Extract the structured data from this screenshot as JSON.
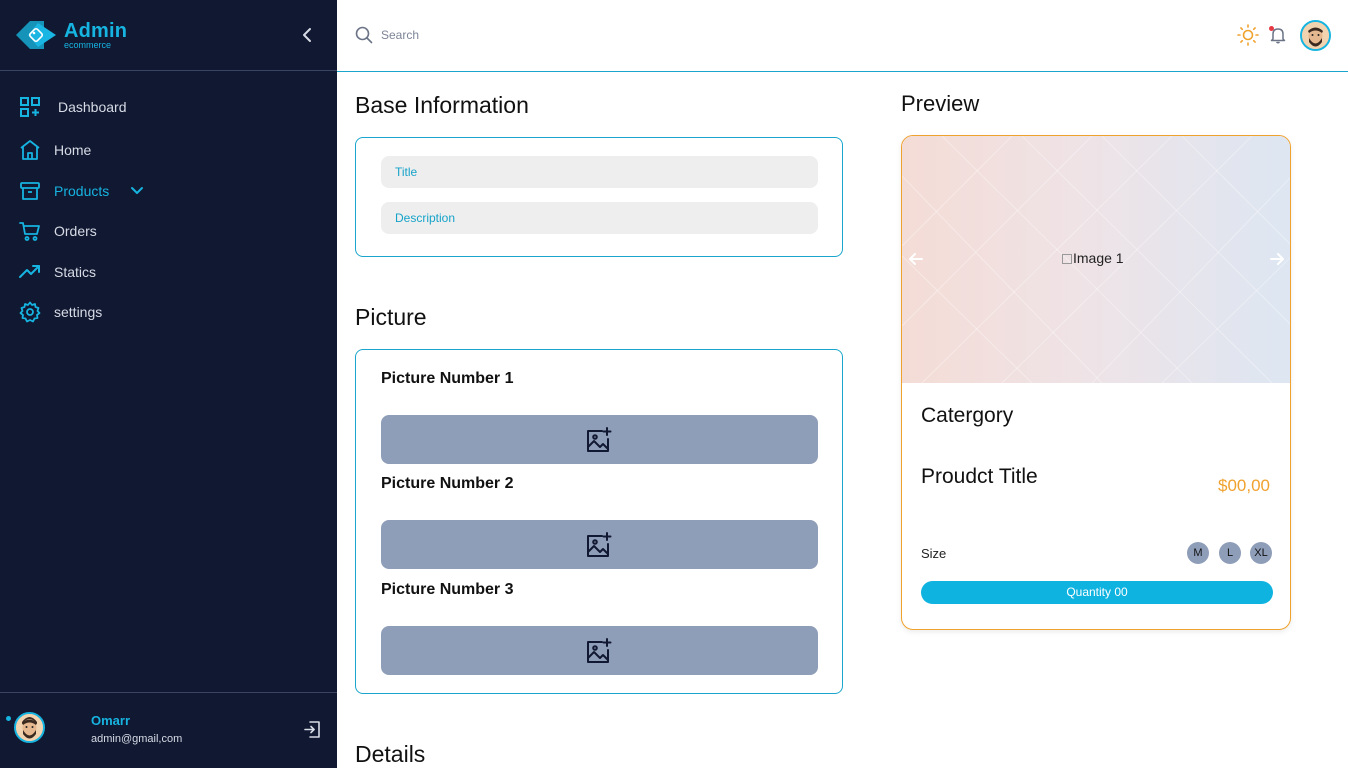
{
  "brand": {
    "name": "Admin",
    "subtitle": "ecommerce"
  },
  "sidebar": {
    "items": [
      {
        "label": "Dashboard",
        "icon": "dashboard-grid-icon"
      },
      {
        "label": "Home",
        "icon": "home-icon"
      },
      {
        "label": "Products",
        "icon": "archive-box-icon",
        "active": true,
        "expandable": true
      },
      {
        "label": "Orders",
        "icon": "cart-icon"
      },
      {
        "label": "Statics",
        "icon": "trending-up-icon"
      },
      {
        "label": "settings",
        "icon": "gear-icon"
      }
    ]
  },
  "user": {
    "name": "Omarr",
    "email": "admin@gmail,com"
  },
  "topbar": {
    "search_placeholder": "Search"
  },
  "base_info": {
    "title": "Base Information",
    "title_placeholder": "Title",
    "description_placeholder": "Description"
  },
  "picture": {
    "title": "Picture",
    "slots": [
      "Picture Number 1",
      "Picture Number 2",
      "Picture Number 3"
    ]
  },
  "details": {
    "title": "Details"
  },
  "preview": {
    "title": "Preview",
    "image_alt": "Image 1",
    "category": "Catergory",
    "product_title": "Proudct Title",
    "price": "$00,00",
    "size_label": "Size",
    "sizes": [
      "M",
      "L",
      "XL"
    ],
    "quantity_label": "Quantity 00"
  },
  "colors": {
    "sidebar_bg": "#111831",
    "accent": "#16b4e1",
    "price": "#f0a22e",
    "upload_bg": "#8e9db8"
  }
}
